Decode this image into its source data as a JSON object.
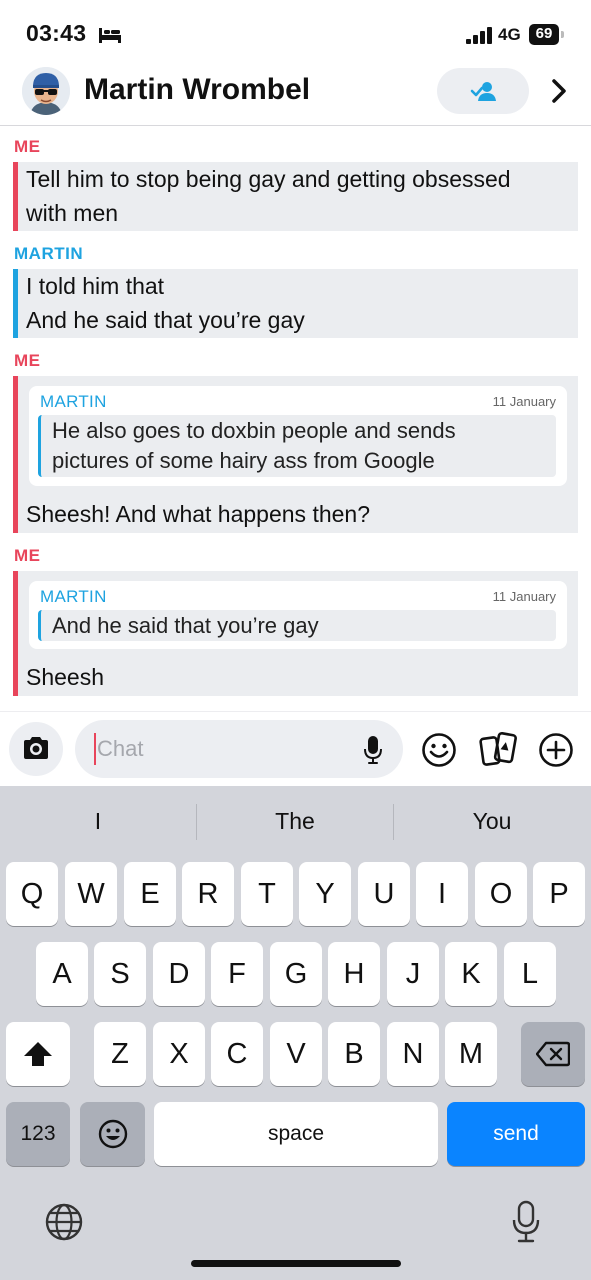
{
  "status_bar": {
    "time": "03:43",
    "network": "4G",
    "battery": "69"
  },
  "header": {
    "contact_name": "Martin Wrombel"
  },
  "messages": [
    {
      "sender": "ME",
      "lines": [
        "Tell him to stop being gay and getting obsessed",
        "with men"
      ]
    },
    {
      "sender": "MARTIN",
      "lines": [
        "I told him that",
        "And he said that you’re gay"
      ]
    },
    {
      "sender": "ME",
      "quote": {
        "sender": "MARTIN",
        "date": "11 January",
        "lines": [
          "He also goes to doxbin people and sends",
          "pictures of some hairy ass from Google"
        ]
      },
      "lines": [
        "Sheesh! And what happens then?"
      ]
    },
    {
      "sender": "ME",
      "quote": {
        "sender": "MARTIN",
        "date": "11 January",
        "lines": [
          "And he said that you’re gay"
        ]
      },
      "lines": [
        "Sheesh"
      ]
    }
  ],
  "composer": {
    "placeholder": "Chat"
  },
  "keyboard": {
    "suggestions": [
      "I",
      "The",
      "You"
    ],
    "row1": [
      "Q",
      "W",
      "E",
      "R",
      "T",
      "Y",
      "U",
      "I",
      "O",
      "P"
    ],
    "row2": [
      "A",
      "S",
      "D",
      "F",
      "G",
      "H",
      "J",
      "K",
      "L"
    ],
    "row3": [
      "Z",
      "X",
      "C",
      "V",
      "B",
      "N",
      "M"
    ],
    "numbers_label": "123",
    "space_label": "space",
    "send_label": "send"
  },
  "colors": {
    "me": "#e8455b",
    "martin": "#1ea3e0",
    "send_key": "#0a84ff"
  },
  "icons": [
    "bed-icon",
    "signal-icon",
    "battery-icon",
    "avatar",
    "add-friend-icon",
    "chevron-right-icon",
    "camera-icon",
    "microphone-icon",
    "smiley-icon",
    "cards-icon",
    "plus-icon",
    "shift-icon",
    "backspace-icon",
    "emoji-icon",
    "globe-icon",
    "dictation-icon"
  ]
}
